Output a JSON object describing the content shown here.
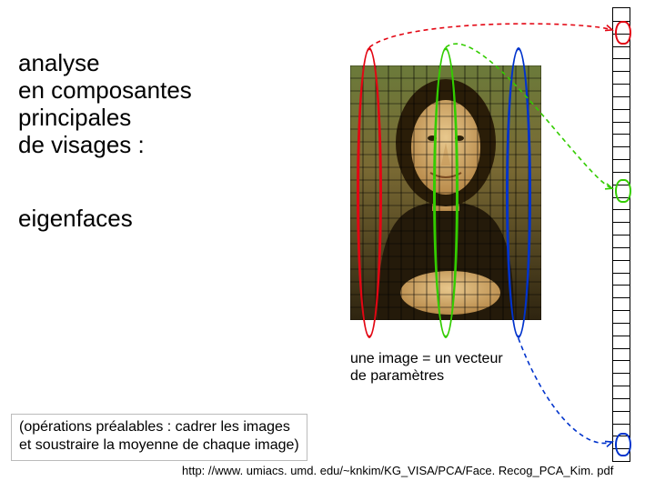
{
  "text": {
    "title_line1": "analyse",
    "title_line2": "en composantes",
    "title_line3": "principales",
    "title_line4": "de visages :",
    "subtitle": "eigenfaces",
    "caption_line1": "une image = un vecteur",
    "caption_line2": "de paramètres",
    "note_line1": "(opérations préalables : cadrer les images",
    "note_line2": "et soustraire la moyenne de chaque image)",
    "source": "http: //www. umiacs. umd. edu/~knkim/KG_VISA/PCA/Face. Recog_PCA_Kim. pdf"
  },
  "colors": {
    "red": "#e30613",
    "green": "#33cc00",
    "blue": "#0033cc"
  },
  "image": {
    "grid_cols": 15,
    "grid_rows": 20,
    "ellipses": [
      {
        "cx_pct": 10,
        "color": "red",
        "vector_row_frac": 0.05
      },
      {
        "cx_pct": 50,
        "color": "green",
        "vector_row_frac": 0.4
      },
      {
        "cx_pct": 88,
        "color": "blue",
        "vector_row_frac": 0.96
      }
    ]
  },
  "vector": {
    "cells": 36
  }
}
